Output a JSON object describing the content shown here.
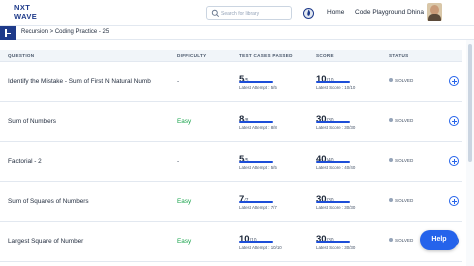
{
  "header": {
    "logo_line1": "NXT",
    "logo_line2": "WAVE",
    "search_placeholder": "Search for library",
    "nav_home": "Home",
    "nav_playground": "Code Playground",
    "user_name": "Dhina"
  },
  "breadcrumb": "Recursion > Coding Practice - 25",
  "table": {
    "headers": {
      "question": "QUESTION",
      "difficulty": "DIFFICULTY",
      "test_cases": "TEST CASES PASSED",
      "score": "SCORE",
      "status": "STATUS"
    },
    "rows": [
      {
        "title": "Identify the Mistake - Sum of First N Natural Numb",
        "difficulty": "-",
        "tests_passed": "5",
        "tests_total": "/5",
        "latest_attempt": "Latest Attempt : 5/5",
        "score": "10",
        "score_total": "/10",
        "latest_score": "Latest Score : 10/10",
        "status": "SOLVED"
      },
      {
        "title": "Sum of Numbers",
        "difficulty": "Easy",
        "tests_passed": "8",
        "tests_total": "/8",
        "latest_attempt": "Latest Attempt : 8/8",
        "score": "30",
        "score_total": "/30",
        "latest_score": "Latest Score : 30/30",
        "status": "SOLVED"
      },
      {
        "title": "Factorial - 2",
        "difficulty": "-",
        "tests_passed": "5",
        "tests_total": "/5",
        "latest_attempt": "Latest Attempt : 5/5",
        "score": "40",
        "score_total": "/40",
        "latest_score": "Latest Score : 40/40",
        "status": "SOLVED"
      },
      {
        "title": "Sum of Squares of Numbers",
        "difficulty": "Easy",
        "tests_passed": "7",
        "tests_total": "/7",
        "latest_attempt": "Latest Attempt : 7/7",
        "score": "30",
        "score_total": "/30",
        "latest_score": "Latest Score : 30/30",
        "status": "SOLVED"
      },
      {
        "title": "Largest Square of Number",
        "difficulty": "Easy",
        "tests_passed": "10",
        "tests_total": "/10",
        "latest_attempt": "Latest Attempt : 10/10",
        "score": "30",
        "score_total": "/30",
        "latest_score": "Latest Score : 30/30",
        "status": "SOLVED"
      }
    ]
  },
  "help_label": "Help",
  "colors": {
    "brand": "#1e3a8a",
    "accent": "#2563eb",
    "progress": "#1d4ed8",
    "easy": "#16a34a"
  },
  "icons": {
    "search": "search-icon",
    "streak": "streak-icon",
    "add": "add-circle-icon"
  }
}
